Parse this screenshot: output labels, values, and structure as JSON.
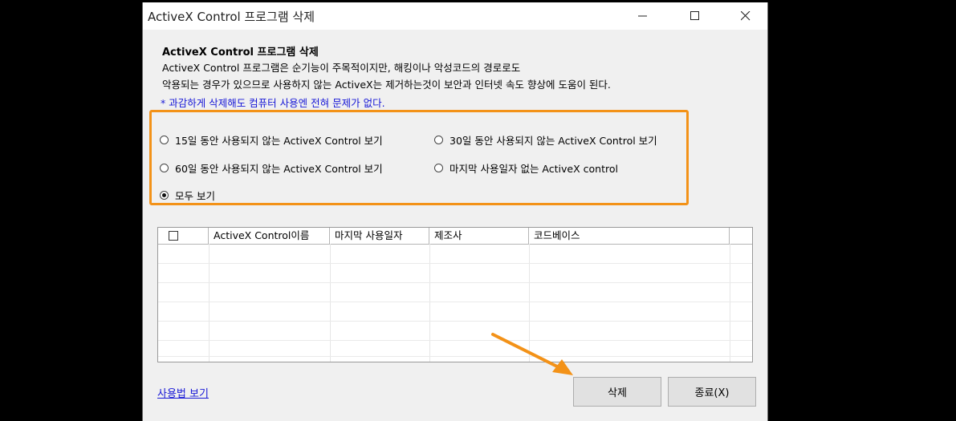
{
  "window": {
    "title": "ActiveX Control 프로그램 삭제"
  },
  "content": {
    "heading": "ActiveX Control 프로그램 삭제",
    "description_line1": "ActiveX Control 프로그램은 순기능이 주목적이지만, 해킹이나 악성코드의 경로로도",
    "description_line2": "악용되는 경우가 있으므로 사용하지 않는 ActiveX는 제거하는것이 보안과 인터넷 속도 향상에 도움이 된다.",
    "note": "* 과감하게 삭제해도 컴퓨터 사용엔 전혀 문제가 없다."
  },
  "filters": {
    "options": [
      {
        "label": "15일 동안 사용되지 않는 ActiveX Control 보기",
        "checked": false
      },
      {
        "label": "30일 동안 사용되지 않는 ActiveX Control 보기",
        "checked": false
      },
      {
        "label": "60일 동안 사용되지 않는 ActiveX Control 보기",
        "checked": false
      },
      {
        "label": "마지막 사용일자 없는 ActiveX control",
        "checked": false
      },
      {
        "label": "모두 보기",
        "checked": true
      }
    ]
  },
  "table": {
    "columns": [
      "",
      "ActiveX Control이름",
      "마지막 사용일자",
      "제조사",
      "코드베이스"
    ],
    "rows": []
  },
  "footer": {
    "help_link": "사용법 보기",
    "delete_label": "삭제",
    "close_label": "종료(X)"
  },
  "colors": {
    "highlight": "#f39218",
    "link": "#1717d6"
  },
  "icons": {
    "minimize": "minimize-icon",
    "maximize": "maximize-icon",
    "close": "close-icon",
    "annotation": "arrow-annotation"
  }
}
